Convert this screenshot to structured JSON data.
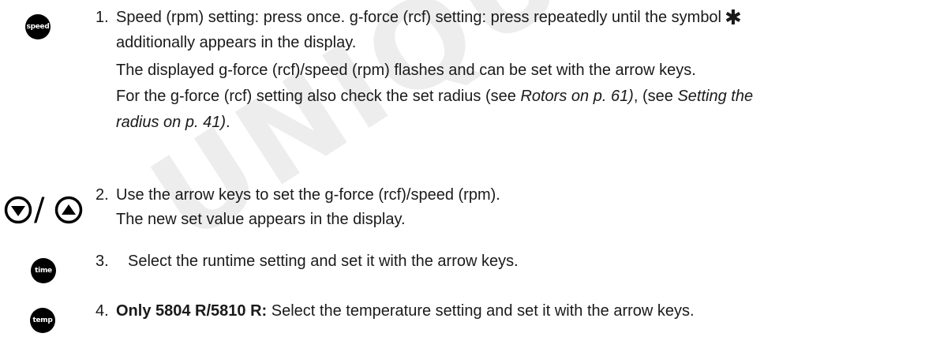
{
  "watermark": "UNIQUE",
  "steps": [
    {
      "number": "1.",
      "key": "speed",
      "line1_a": "Speed (rpm) setting: press once. g-force (rcf) setting: press repeatedly until the symbol",
      "line2": "additionally appears in the display.",
      "line3": "The displayed g-force (rcf)/speed (rpm) flashes and can be set with the arrow keys.",
      "line4_a": "For the g-force (rcf) setting also check the set radius (see ",
      "line4_link1": "Rotors on p. 61)",
      "line4_b": ", (see ",
      "line4_link2": "Setting the",
      "line5_link2": "radius on p. 41)",
      "line5_end": "."
    },
    {
      "number": "2.",
      "key": "down / up arrow keys",
      "slash": "/",
      "line1": "Use the arrow keys to set the g-force (rcf)/speed (rpm).",
      "line2": "The new set value appears in the display."
    },
    {
      "number": "3.",
      "key": "time",
      "line1": "Select the runtime setting and set it with the arrow keys."
    },
    {
      "number": "4.",
      "key": "temp",
      "line1_bold": "Only 5804 R/5810 R:",
      "line1_rest": " Select the temperature setting and set it with the arrow keys."
    }
  ],
  "icons": {
    "star": "asterisk-icon",
    "down": "arrow-down-circle-icon",
    "up": "arrow-up-circle-icon"
  }
}
